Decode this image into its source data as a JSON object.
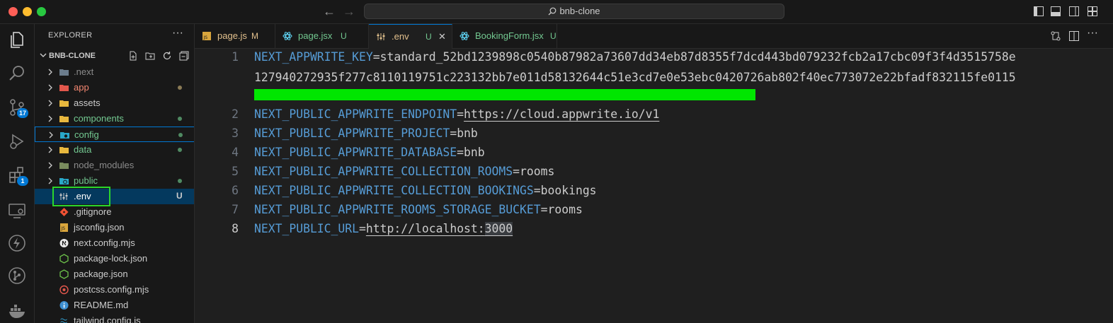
{
  "window": {
    "title": "bnb-clone"
  },
  "activity": {
    "scm_badge": "17",
    "extensions_badge": "1"
  },
  "explorer": {
    "title": "EXPLORER",
    "more": "···",
    "project": "BNB-CLONE",
    "items": [
      {
        "name": ".next",
        "kind": "folder",
        "color": "#8b8b8b"
      },
      {
        "name": "app",
        "kind": "folder",
        "color": "#f48771"
      },
      {
        "name": "assets",
        "kind": "folder",
        "color": "#cccccc"
      },
      {
        "name": "components",
        "kind": "folder",
        "color": "#73c991"
      },
      {
        "name": "config",
        "kind": "folder",
        "color": "#73c991"
      },
      {
        "name": "data",
        "kind": "folder",
        "color": "#73c991"
      },
      {
        "name": "node_modules",
        "kind": "folder",
        "color": "#8b8b8b"
      },
      {
        "name": "public",
        "kind": "folder",
        "color": "#73c991"
      },
      {
        "name": ".env",
        "kind": "file",
        "color": "#cccccc",
        "status": "U"
      },
      {
        "name": ".gitignore",
        "kind": "file",
        "color": "#cccccc"
      },
      {
        "name": "jsconfig.json",
        "kind": "file",
        "color": "#cccccc"
      },
      {
        "name": "next.config.mjs",
        "kind": "file",
        "color": "#cccccc"
      },
      {
        "name": "package-lock.json",
        "kind": "file",
        "color": "#cccccc"
      },
      {
        "name": "package.json",
        "kind": "file",
        "color": "#cccccc"
      },
      {
        "name": "postcss.config.mjs",
        "kind": "file",
        "color": "#cccccc"
      },
      {
        "name": "README.md",
        "kind": "file",
        "color": "#cccccc"
      },
      {
        "name": "tailwind.config.js",
        "kind": "file",
        "color": "#cccccc"
      }
    ]
  },
  "tabs": [
    {
      "label": "page.js",
      "status": "M",
      "color": "#e2c08d"
    },
    {
      "label": "page.jsx",
      "status": "U",
      "color": "#73c991"
    },
    {
      "label": ".env",
      "status": "U",
      "color": "#e2c08d",
      "close": "✕"
    },
    {
      "label": "BookingForm.jsx",
      "status": "U",
      "color": "#73c991"
    }
  ],
  "editor": {
    "line_numbers": [
      "1",
      "2",
      "3",
      "4",
      "5",
      "6",
      "7",
      "8"
    ],
    "lines": [
      {
        "key": "NEXT_APPWRITE_KEY",
        "eq": "=",
        "value": "standard_52bd1239898c0540b87982a73607dd34eb87d8355f7dcd443bd079232fcb2a17cbc09f3f4d3515758e"
      },
      {
        "cont": "127940272935f277c8110119751c223132bb7e011d58132644c51e3cd7e0e53ebc0420726ab802f40ec773072e22bfadf832115fe0115"
      },
      {
        "key": "NEXT_PUBLIC_APPWRITE_ENDPOINT",
        "eq": "=",
        "value": "https://cloud.appwrite.io/v1"
      },
      {
        "key": "NEXT_PUBLIC_APPWRITE_PROJECT",
        "eq": "=",
        "value": "bnb"
      },
      {
        "key": "NEXT_PUBLIC_APPWRITE_DATABASE",
        "eq": "=",
        "value": "bnb"
      },
      {
        "key": "NEXT_PUBLIC_APPWRITE_COLLECTION_ROOMS",
        "eq": "=",
        "value": "rooms"
      },
      {
        "key": "NEXT_PUBLIC_APPWRITE_COLLECTION_BOOKINGS",
        "eq": "=",
        "value": "bookings"
      },
      {
        "key": "NEXT_PUBLIC_APPWRITE_ROOMS_STORAGE_BUCKET",
        "eq": "=",
        "value": "rooms"
      },
      {
        "key": "NEXT_PUBLIC_URL",
        "eq": "=",
        "value_a": "http://localhost:",
        "value_b": "3000"
      }
    ]
  },
  "colors": {
    "accent": "#0078d4",
    "keyword": "#569cd6",
    "added": "#73c991",
    "redaction": "#00e600"
  }
}
